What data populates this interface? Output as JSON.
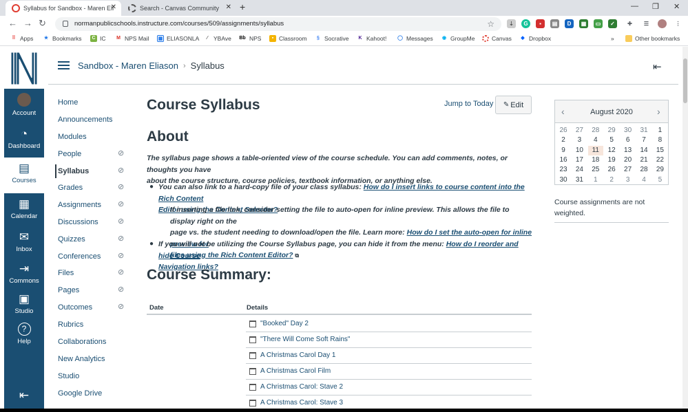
{
  "browser": {
    "tabs": [
      {
        "title": "Syllabus for Sandbox - Maren Eli",
        "active": true
      },
      {
        "title": "Search - Canvas Community",
        "active": false
      }
    ],
    "url": "normanpublicschools.instructure.com/courses/509/assignments/syllabus",
    "bookmarks": [
      "Apps",
      "Bookmarks",
      "IC",
      "NPS Mail",
      "ELIASONLA",
      "YBAve",
      "NPS",
      "Classroom",
      "Socrative",
      "Kahoot!",
      "Messages",
      "GroupMe",
      "Canvas",
      "Dropbox",
      "Other bookmarks"
    ],
    "overflow": "»"
  },
  "global_nav": [
    {
      "label": "Account",
      "icon": "avatar-icon"
    },
    {
      "label": "Dashboard",
      "icon": "dashboard-icon"
    },
    {
      "label": "Courses",
      "icon": "courses-icon",
      "active": true
    },
    {
      "label": "Calendar",
      "icon": "calendar-icon"
    },
    {
      "label": "Inbox",
      "icon": "inbox-icon"
    },
    {
      "label": "Commons",
      "icon": "commons-icon"
    },
    {
      "label": "Studio",
      "icon": "studio-icon"
    },
    {
      "label": "Help",
      "icon": "help-icon"
    }
  ],
  "breadcrumb": {
    "course": "Sandbox - Maren Eliason",
    "separator": "›",
    "current": "Syllabus"
  },
  "course_nav": [
    "Home",
    "Announcements",
    "Modules",
    "People",
    "Syllabus",
    "Grades",
    "Assignments",
    "Discussions",
    "Quizzes",
    "Conferences",
    "Files",
    "Pages",
    "Outcomes",
    "Rubrics",
    "Collaborations",
    "New Analytics",
    "Studio",
    "Google Drive"
  ],
  "hidden_items": [
    "People",
    "Syllabus",
    "Grades",
    "Assignments",
    "Discussions",
    "Quizzes",
    "Conferences",
    "Files",
    "Pages",
    "Outcomes"
  ],
  "active_item": "Syllabus",
  "main": {
    "title": "Course Syllabus",
    "jump_to_today": "Jump to Today",
    "edit_label": "Edit",
    "about_heading": "About",
    "intro_line1": "The syllabus page shows a table-oriented view of the course schedule. You can add comments, notes, or thoughts you have",
    "intro_line2": "about the course structure, course policies, textbook information, or anything else.",
    "b1_text": "You can also link to a hard-copy file of your class syllabus: ",
    "b1_link1": "How do I insert links to course content into the Rich Content",
    "b1_link2": "Editor using the Content Selector?",
    "b2_line1": "If inserting a file link, consider setting the file to auto-open for inline preview. This allows the file to display right on the",
    "b2_text2": "page vs. the student needing to download/open the file. Learn more: ",
    "b2_link1": "How do I set the auto-open for inline preview for",
    "b2_link2": "files using the Rich Content Editor?",
    "b3_text": "If you will not be utilizing the Course Syllabus page, you can hide it from the menu: ",
    "b3_link1": "How do I reorder and hide Course",
    "b3_link2": "Navigation links?",
    "summary_heading": "Course Summary:",
    "col_date": "Date",
    "col_details": "Details",
    "rows": [
      "\"Booked\" Day 2",
      "\"There Will Come Soft Rains\"",
      "A Christmas Carol Day 1",
      "A Christmas Carol Film",
      "A Christmas Carol: Stave 2",
      "A Christmas Carol: Stave 3"
    ]
  },
  "calendar": {
    "month": "August 2020",
    "weeks": [
      [
        "26",
        "27",
        "28",
        "29",
        "30",
        "31",
        "1"
      ],
      [
        "2",
        "3",
        "4",
        "5",
        "6",
        "7",
        "8"
      ],
      [
        "9",
        "10",
        "11",
        "12",
        "13",
        "14",
        "15"
      ],
      [
        "16",
        "17",
        "18",
        "19",
        "20",
        "21",
        "22"
      ],
      [
        "23",
        "24",
        "25",
        "26",
        "27",
        "28",
        "29"
      ],
      [
        "30",
        "31",
        "1",
        "2",
        "3",
        "4",
        "5"
      ]
    ],
    "today": "11"
  },
  "sidebar_note": "Course assignments are not weighted.",
  "colors": {
    "nav": "#1a4e72",
    "link": "#1a4e72",
    "text": "#2d3b45"
  }
}
